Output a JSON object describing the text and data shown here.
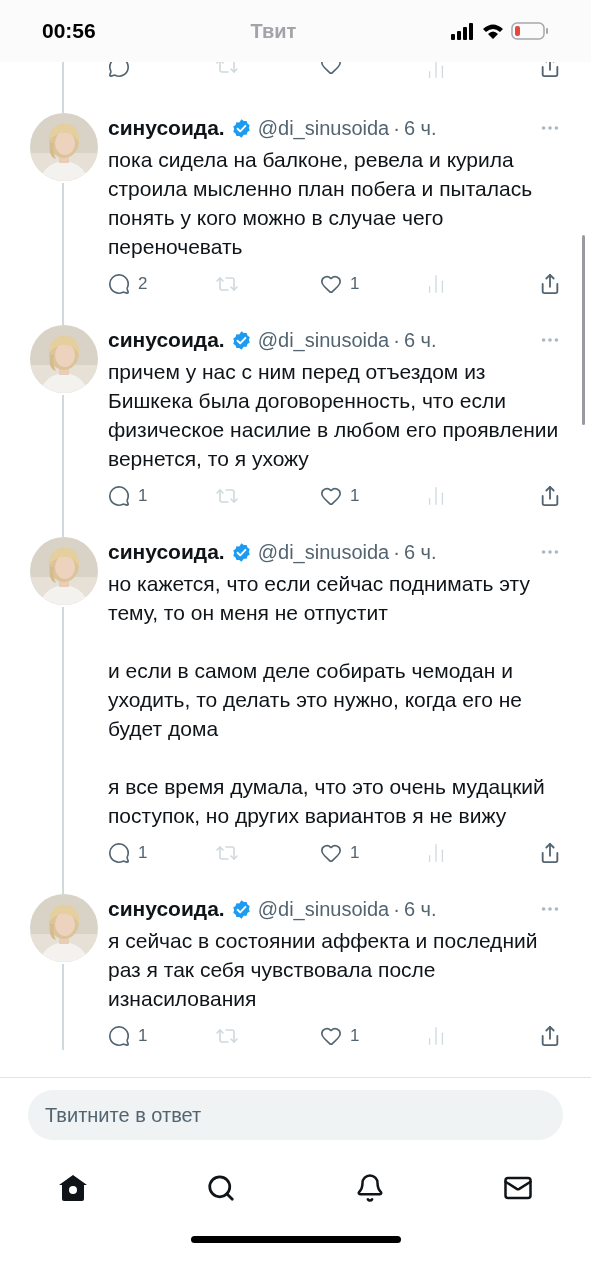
{
  "status_bar": {
    "time": "00:56"
  },
  "header": {
    "title": "Твит"
  },
  "separator": "·",
  "tweets": [
    {
      "name": "синусоида.",
      "verified": true,
      "handle": "@di_sinusoida",
      "time": "6 ч.",
      "paragraphs": [
        "пока сидела на балконе, ревела и курила строила мысленно план побега и пыталась понять у кого можно в случае чего переночевать"
      ],
      "replies": "2",
      "likes": "1"
    },
    {
      "name": "синусоида.",
      "verified": true,
      "handle": "@di_sinusoida",
      "time": "6 ч.",
      "paragraphs": [
        "причем у нас с ним перед отъездом из Бишкека была договоренность, что если физическое насилие в любом его проявлении вернется, то я ухожу"
      ],
      "replies": "1",
      "likes": "1"
    },
    {
      "name": "синусоида.",
      "verified": true,
      "handle": "@di_sinusoida",
      "time": "6 ч.",
      "paragraphs": [
        "но кажется, что если сейчас поднимать эту тему, то он меня не отпустит",
        "и если в самом деле собирать чемодан и уходить, то делать это нужно, когда его не будет дома",
        "я все время думала, что это очень мудацкий поступок, но других вариантов я не вижу"
      ],
      "replies": "1",
      "likes": "1"
    },
    {
      "name": "синусоида.",
      "verified": true,
      "handle": "@di_sinusoida",
      "time": "6 ч.",
      "paragraphs": [
        "я сейчас в состоянии аффекта и последний раз я так себя чувствовала после изнасилования"
      ],
      "replies": "1",
      "likes": "1"
    }
  ],
  "reply_field": {
    "placeholder": "Твитните в ответ"
  },
  "nav": [
    {
      "kind": "home",
      "selected": true
    },
    {
      "kind": "search",
      "selected": false
    },
    {
      "kind": "notifications",
      "selected": false
    },
    {
      "kind": "messages",
      "selected": false
    }
  ]
}
